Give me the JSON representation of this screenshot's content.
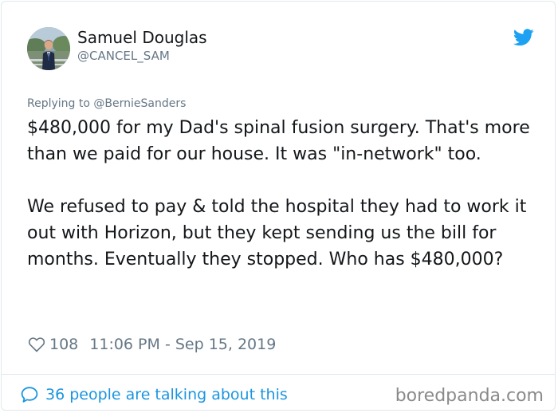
{
  "user": {
    "display_name": "Samuel Douglas",
    "handle": "@CANCEL_SAM",
    "avatar_icon": "profile-photo"
  },
  "brand": {
    "icon": "twitter-bird-icon",
    "color": "#1da1f2"
  },
  "tweet": {
    "reply_to": "Replying to @BernieSanders",
    "paragraphs": [
      "$480,000 for my Dad's spinal fusion surgery. That's more than we paid for our house. It was \"in-network\" too.",
      "We refused to pay & told the hospital they had to work it out with Horizon, but they kept sending us the bill for months. Eventually they stopped. Who has $480,000?"
    ],
    "like_icon": "heart-icon",
    "like_count": "108",
    "timestamp": "11:06 PM - Sep 15, 2019"
  },
  "footer": {
    "icon": "speech-bubble-icon",
    "conversation_text": "36 people are talking about this",
    "link_color": "#1b95e0"
  },
  "watermark": "boredpanda.com",
  "colors": {
    "text": "#14171a",
    "secondary": "#657786",
    "border": "#e1e8ed"
  }
}
